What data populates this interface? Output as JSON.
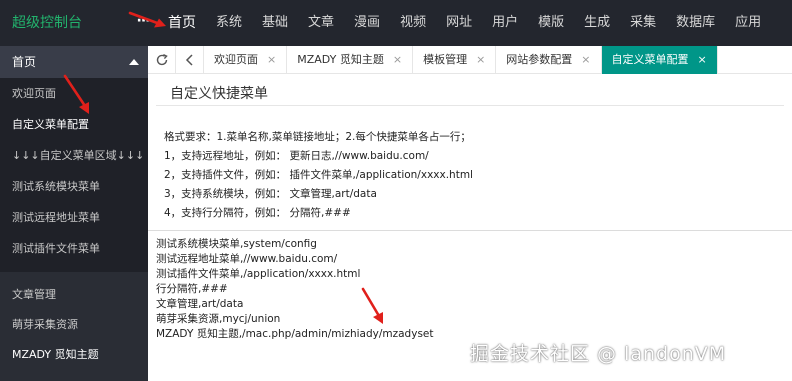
{
  "brand": "超级控制台",
  "topnav": {
    "items": [
      {
        "label": "首页",
        "active": true
      },
      {
        "label": "系统"
      },
      {
        "label": "基础"
      },
      {
        "label": "文章"
      },
      {
        "label": "漫画"
      },
      {
        "label": "视频"
      },
      {
        "label": "网址"
      },
      {
        "label": "用户"
      },
      {
        "label": "模版"
      },
      {
        "label": "生成"
      },
      {
        "label": "采集"
      },
      {
        "label": "数据库"
      },
      {
        "label": "应用"
      }
    ]
  },
  "sidebar": {
    "home_label": "首页",
    "sub_items": [
      {
        "label": "欢迎页面"
      },
      {
        "label": "自定义菜单配置",
        "active": true
      },
      {
        "label": "↓↓↓自定义菜单区域↓↓↓"
      },
      {
        "label": "测试系统模块菜单"
      },
      {
        "label": "测试远程地址菜单"
      },
      {
        "label": "测试插件文件菜单"
      }
    ],
    "groups": [
      {
        "label": "文章管理"
      },
      {
        "label": "萌芽采集资源"
      },
      {
        "label": "MZADY 觅知主题"
      }
    ]
  },
  "tabs": [
    {
      "label": "欢迎页面",
      "close": "×"
    },
    {
      "label": "MZADY 觅知主题",
      "close": "×"
    },
    {
      "label": "模板管理",
      "close": "×"
    },
    {
      "label": "网站参数配置",
      "close": "×"
    },
    {
      "label": "自定义菜单配置",
      "close": "×",
      "active": true
    }
  ],
  "main": {
    "title": "自定义快捷菜单",
    "tips": [
      "格式要求：1.菜单名称,菜单链接地址；2.每个快捷菜单各占一行；",
      "1，支持远程地址，例如： 更新日志,//www.baidu.com/",
      "2，支持插件文件，例如： 插件文件菜单,/application/xxxx.html",
      "3，支持系统模块，例如： 文章管理,art/data",
      "4，支持行分隔符，例如： 分隔符,###"
    ],
    "editor_lines": [
      "测试系统模块菜单,system/config",
      "测试远程地址菜单,//www.baidu.com/",
      "测试插件文件菜单,/application/xxxx.html",
      "行分隔符,###",
      "文章管理,art/data",
      "萌芽采集资源,mycj/union",
      "MZADY 觅知主题,/mac.php/admin/mizhiady/mzadyset"
    ]
  },
  "watermark": "掘金技术社区 @ landonVM",
  "colors": {
    "topbar": "#23262e",
    "brand": "#22b36d",
    "sidebar": "#2a2d35",
    "active_tab": "#009688",
    "arrow": "#e0201b"
  },
  "icons": {
    "more": "more-icon",
    "caret": "caret-up-icon",
    "refresh": "refresh-icon",
    "back": "chevron-left-icon",
    "close": "close-icon",
    "annotation": "arrow-annotation"
  }
}
